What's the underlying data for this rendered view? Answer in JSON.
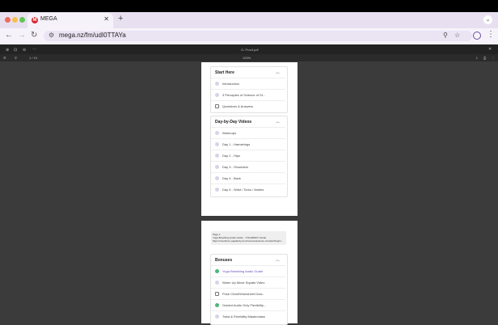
{
  "browser": {
    "tab_title": "MEGA",
    "tab_favicon": "M",
    "new_tab_label": "+",
    "url": "mega.nz/fm/udI0TTAYa"
  },
  "pdf_viewer": {
    "filename": "G..Proof.pdf",
    "page_indicator": "1 / 10",
    "zoom": "100%"
  },
  "course": {
    "sections": [
      {
        "title": "Start Here",
        "items": [
          {
            "label": "Introduction",
            "icon": "play-icon"
          },
          {
            "label": "3 Principles of Science of St...",
            "icon": "play-icon"
          },
          {
            "label": "Questions & Answers",
            "icon": "chat-icon"
          }
        ]
      },
      {
        "title": "Day-by-Day Videos",
        "items": [
          {
            "label": "Warmups",
            "icon": "play-icon"
          },
          {
            "label": "Day 1 - Hamstrings",
            "icon": "play-icon"
          },
          {
            "label": "Day 2 - Hips",
            "icon": "play-icon"
          },
          {
            "label": "Day 3 - Shoulders",
            "icon": "play-icon"
          },
          {
            "label": "Day 4 - Back",
            "icon": "play-icon"
          },
          {
            "label": "Day 5 - Wrist / Torso / Ankles",
            "icon": "play-icon"
          }
        ]
      },
      {
        "title": "Bonuses",
        "items": [
          {
            "label": "Yoga Breathing Audio Guide",
            "icon": "check-icon"
          },
          {
            "label": "Warm Up Move Squats Video",
            "icon": "play-icon"
          },
          {
            "label": "Pose Chart/Worksheet Dow...",
            "icon": "doc-icon"
          },
          {
            "label": "Guided Audio Only Flexibility...",
            "icon": "check-icon"
          },
          {
            "label": "Twist & Flexibility Masterclass",
            "icon": "play-icon"
          }
        ]
      }
    ],
    "page_footer": {
      "line1": "Page 1",
      "line2": "Yoga Breathing Audio Guide - YOGABODY Guide",
      "line3": "https://members.yogabody.com/courses/science-of-stretching/m..."
    }
  }
}
